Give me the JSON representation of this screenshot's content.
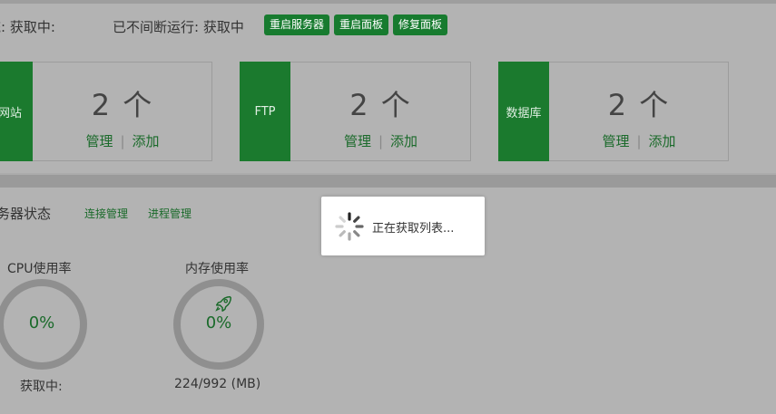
{
  "status_bar": {
    "system_status": "统: 获取中:",
    "uptime": "已不间断运行: 获取中",
    "restart_server_label": "重启服务器",
    "restart_panel_label": "重启面板",
    "repair_panel_label": "修复面板",
    "button_color": "#177b2f"
  },
  "cards": [
    {
      "side_label": "网站",
      "count": "2 个",
      "manage_label": "管理",
      "add_label": "添加"
    },
    {
      "side_label": "FTP",
      "count": "2 个",
      "manage_label": "管理",
      "add_label": "添加"
    },
    {
      "side_label": "数据库",
      "count": "2 个",
      "manage_label": "管理",
      "add_label": "添加"
    }
  ],
  "server_status": {
    "title": "务器状态",
    "connection_link": "连接管理",
    "process_link": "进程管理"
  },
  "gauges": [
    {
      "label": "CPU使用率",
      "value": "0%",
      "sub": "获取中:"
    },
    {
      "label": "内存使用率",
      "value": "0%",
      "sub": "224/992 (MB)",
      "icon": "rocket-icon"
    }
  ],
  "loading": {
    "text": "正在获取列表..."
  }
}
